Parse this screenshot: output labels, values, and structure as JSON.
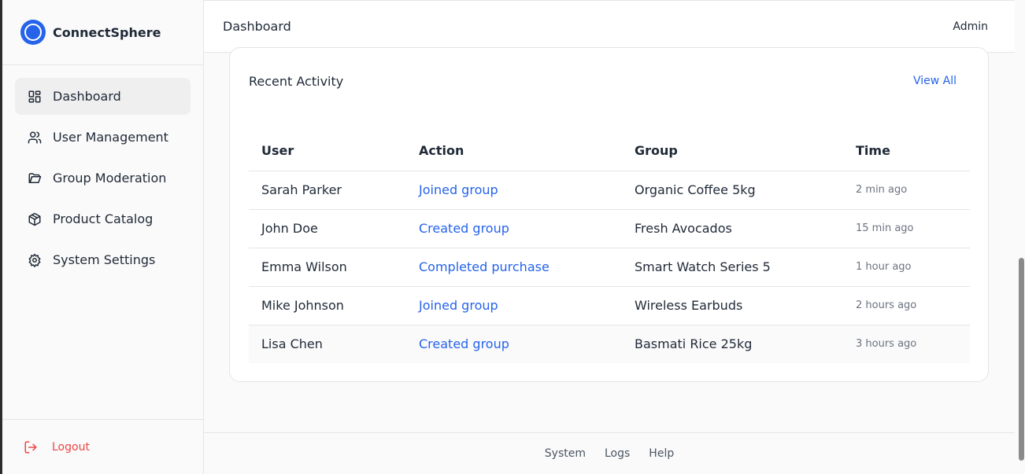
{
  "brand": {
    "name": "ConnectSphere"
  },
  "sidebar": {
    "items": [
      {
        "label": "Dashboard",
        "icon": "dashboard-icon"
      },
      {
        "label": "User Management",
        "icon": "users-icon"
      },
      {
        "label": "Group Moderation",
        "icon": "folder-icon"
      },
      {
        "label": "Product Catalog",
        "icon": "package-icon"
      },
      {
        "label": "System Settings",
        "icon": "gear-icon"
      }
    ],
    "logout": "Logout"
  },
  "topbar": {
    "title": "Dashboard",
    "user": "Admin"
  },
  "activity": {
    "title": "Recent Activity",
    "view_all": "View All",
    "headers": [
      "User",
      "Action",
      "Group",
      "Time"
    ],
    "rows": [
      {
        "user": "Sarah Parker",
        "action": "Joined group",
        "group": "Organic Coffee 5kg",
        "time": "2 min ago"
      },
      {
        "user": "John Doe",
        "action": "Created group",
        "group": "Fresh Avocados",
        "time": "15 min ago"
      },
      {
        "user": "Emma Wilson",
        "action": "Completed purchase",
        "group": "Smart Watch Series 5",
        "time": "1 hour ago"
      },
      {
        "user": "Mike Johnson",
        "action": "Joined group",
        "group": "Wireless Earbuds",
        "time": "2 hours ago"
      },
      {
        "user": "Lisa Chen",
        "action": "Created group",
        "group": "Basmati Rice 25kg",
        "time": "3 hours ago"
      }
    ]
  },
  "footer": {
    "links": [
      "System",
      "Logs",
      "Help"
    ]
  },
  "colors": {
    "accent": "#2563eb",
    "danger": "#ef4444"
  }
}
